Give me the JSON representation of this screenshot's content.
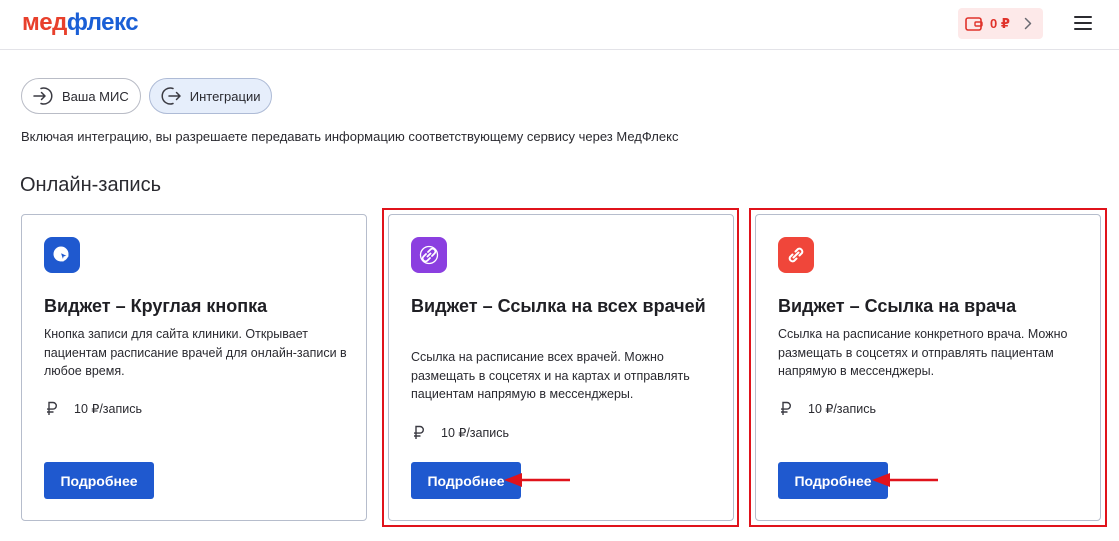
{
  "header": {
    "logo_part1": "мед",
    "logo_part2": "флекс",
    "balance": "0 ₽"
  },
  "tabs": [
    {
      "label": "Ваша МИС",
      "icon": "login-arrow-icon",
      "active": false
    },
    {
      "label": "Интеграции",
      "icon": "logout-arrow-icon",
      "active": true
    }
  ],
  "info_text": "Включая интеграцию, вы разрешаете передавать информацию соответствующему сервису через МедФлекс",
  "section_title": "Онлайн-запись",
  "cards": [
    {
      "title": "Виджет – Круглая кнопка",
      "description": "Кнопка записи для сайта клиники. Открывает пациентам расписание врачей для онлайн-записи в любое время.",
      "price": "10 ₽/запись",
      "button": "Подробнее",
      "icon": "cursor-click-icon",
      "icon_color": "#1f59cf"
    },
    {
      "title": "Виджет – Ссылка на всех врачей",
      "description": "Ссылка на расписание всех врачей. Можно размещать в соцсетях и на картах и отправлять пациентам напрямую в мессенджеры.",
      "price": "10 ₽/запись",
      "button": "Подробнее",
      "icon": "double-link-icon",
      "icon_color": "#8b3fe0"
    },
    {
      "title": "Виджет – Ссылка на врача",
      "description": "Ссылка на расписание конкретного врача. Можно размещать в соцсетях и отправлять пациентам напрямую в мессенджеры.",
      "price": "10 ₽/запись",
      "button": "Подробнее",
      "icon": "link-icon",
      "icon_color": "#f0463a"
    }
  ],
  "colors": {
    "accent": "#1f59cf",
    "highlight": "#e0131b",
    "logo_red": "#e8402c",
    "logo_blue": "#1a5fd6"
  }
}
